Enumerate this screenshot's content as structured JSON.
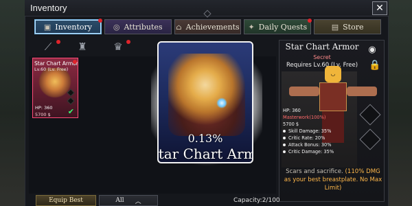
{
  "window": {
    "title": "Inventory"
  },
  "tabs": [
    {
      "label": "Inventory",
      "icon": "bag-icon",
      "has_dot": true
    },
    {
      "label": "Attributes",
      "icon": "swirl-icon",
      "has_dot": false
    },
    {
      "label": "Achievements",
      "icon": "temple-icon",
      "has_dot": false
    },
    {
      "label": "Daily Quests",
      "icon": "quest-icon",
      "has_dot": true
    },
    {
      "label": "Store",
      "icon": "chest-icon",
      "has_dot": false
    }
  ],
  "filters": [
    {
      "name": "filter-weapons",
      "icon": "sword-icon"
    },
    {
      "name": "filter-helmets",
      "icon": "helmet-icon"
    },
    {
      "name": "filter-armor",
      "icon": "armor-icon"
    }
  ],
  "inventory_item": {
    "name": "Star Chart Armor",
    "requirement": "Lv.60 (Lv. Free)",
    "hp": "HP: 360",
    "price": "5700 $"
  },
  "preview": {
    "drop_chance": "0.13%",
    "name": "Star Chart Armor"
  },
  "details": {
    "name": "Star Chart Armor",
    "rarity": "Secret",
    "requirement": "Requires Lv.60 (Lv. Free)",
    "stats": {
      "hp": "HP: 360",
      "masterwork": "Masterwork(100%)",
      "price": "5700 $",
      "lines": [
        "Skill Damage: 35%",
        "Critic Rate: 20%",
        "Attack Bonus: 30%",
        "Critic Damage: 35%"
      ]
    },
    "description_prefix": "Scars and sacrifice.",
    "description_accent": "(110% DMG as your best breastplate. No Max Limit)"
  },
  "bottom": {
    "equip_best": "Equip Best",
    "filter_all": "All",
    "capacity": "Capacity:2/100"
  },
  "colors": {
    "accent_inventory_tab": "#76b8e6",
    "rarity_secret": "#ff8a8a",
    "notification": "#e0242b",
    "equipped_check": "#39ff74"
  }
}
